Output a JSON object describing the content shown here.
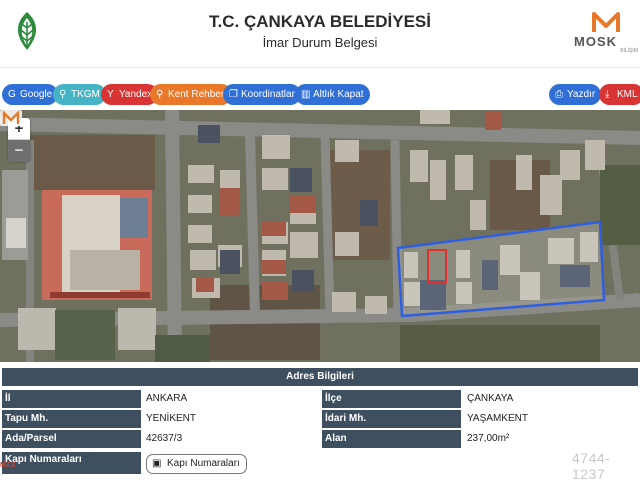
{
  "header": {
    "title": "T.C. ÇANKAYA BELEDİYESİ",
    "subtitle": "İmar Durum Belgesi",
    "brand_text": "MOSK",
    "brand_subtext": "BİLİŞİM"
  },
  "toolbar": {
    "google": {
      "label": "Google",
      "icon": "google-icon",
      "color": "#2f6fd6"
    },
    "tkgm": {
      "label": "TKGM",
      "icon": "location-pin-icon",
      "color": "#45b5c5"
    },
    "yandex": {
      "label": "Yandex",
      "icon": "yandex-icon",
      "color": "#d93434"
    },
    "kent_rehberi": {
      "label": "Kent Rehberi",
      "icon": "location-pin-icon",
      "color": "#e9782b"
    },
    "koordinatlar": {
      "label": "Koordinatlar",
      "icon": "copy-icon",
      "color": "#2f6fd6"
    },
    "altlik_kapat": {
      "label": "Altlık Kapat",
      "icon": "map-icon",
      "color": "#2f6fd6"
    },
    "yazdir": {
      "label": "Yazdır",
      "icon": "printer-icon",
      "color": "#2f6fd6"
    },
    "kml": {
      "label": "KML",
      "icon": "download-icon",
      "color": "#d93434"
    }
  },
  "map": {
    "zoom_in": "+",
    "zoom_out": "−",
    "highlight_color": "#2f5fe0",
    "parcel_color": "#e03030"
  },
  "address": {
    "section_title": "Adres Bilgileri",
    "il_label": "İl",
    "il_value": "ANKARA",
    "ilce_label": "İlçe",
    "ilce_value": "ÇANKAYA",
    "tapu_label": "Tapu Mh.",
    "tapu_value": "YENİKENT",
    "idari_label": "İdari Mh.",
    "idari_value": "YAŞAMKENT",
    "ada_label": "Ada/Parsel",
    "ada_value": "42637/3",
    "alan_label": "Alan",
    "alan_value": "237,00m²",
    "kapi_label": "Kapı Numaraları",
    "kapi_button": "Kapı Numaraları"
  },
  "watermark": "4744-1237",
  "corner_mark": "MAX",
  "colors": {
    "header_bar": "#3e5060",
    "primary": "#2f6fd6",
    "danger": "#d93434",
    "teal": "#45b5c5",
    "orange": "#e9782b"
  }
}
